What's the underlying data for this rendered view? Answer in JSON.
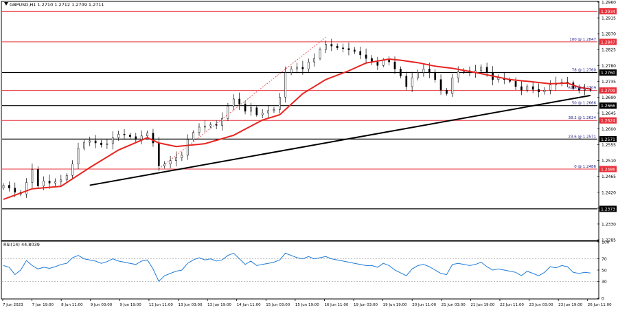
{
  "chart_data": [
    {
      "type": "candlestick",
      "symbol_header": "GBPUSD,H1  1.2710 1.2712 1.2709 1.2711",
      "ylim": [
        1.2285,
        1.296
      ],
      "y_ticks": [
        "1.2960",
        "1.2915",
        "1.2870",
        "1.2825",
        "1.2780",
        "1.2735",
        "1.2690",
        "1.2645",
        "1.2600",
        "1.2555",
        "1.2510",
        "1.2465",
        "1.2420",
        "1.2375",
        "1.2330",
        "1.2285"
      ],
      "x_ticks": [
        "7 Jun 2023",
        "7 Jun 19:00",
        "8 Jun 11:00",
        "9 Jun 03:00",
        "9 Jun 19:00",
        "12 Jun 11:00",
        "13 Jun 03:00",
        "13 Jun 19:00",
        "14 Jun 11:00",
        "15 Jun 03:00",
        "15 Jun 19:00",
        "16 Jun 11:00",
        "19 Jun 03:00",
        "19 Jun 19:00",
        "20 Jun 11:00",
        "21 Jun 03:00",
        "21 Jun 19:00",
        "22 Jun 11:00",
        "23 Jun 03:00",
        "23 Jun 19:00",
        "26 Jun 11:00"
      ],
      "horizontal_levels": [
        {
          "price": 1.2934,
          "label": "1.2934",
          "color": "#e8303a"
        },
        {
          "price": 1.2847,
          "label": "1.2847",
          "color": "#e8303a",
          "annotation": "100 @ 1.2847"
        },
        {
          "price": 1.276,
          "label": "1.2760",
          "color": "#000000",
          "annotation": "78 @ 1.2760"
        },
        {
          "price": 1.2709,
          "label": "1.2709",
          "color": "#e8303a",
          "annotation": "61.8 @ 1.2709"
        },
        {
          "price": 1.2666,
          "label": "1.2666",
          "color": "#000000",
          "annotation": "50 @ 1.2666"
        },
        {
          "price": 1.2624,
          "label": "1.2624",
          "color": "#e8303a",
          "annotation": "38.2 @ 1.2624"
        },
        {
          "price": 1.2571,
          "label": "1.2571",
          "color": "#000000",
          "annotation": "23.6 @ 1.2571"
        },
        {
          "price": 1.2486,
          "label": "1.2486",
          "color": "#e8303a",
          "annotation": "0 @ 1.2486"
        },
        {
          "price": 1.2373,
          "label": "1.2373",
          "color": "#000000"
        }
      ],
      "close_path": [
        [
          0,
          1.244
        ],
        [
          1,
          1.2432
        ],
        [
          2,
          1.242
        ],
        [
          3,
          1.2415
        ],
        [
          4,
          1.2448
        ],
        [
          5,
          1.2485
        ],
        [
          6,
          1.2438
        ],
        [
          7,
          1.2452
        ],
        [
          8,
          1.2446
        ],
        [
          9,
          1.245
        ],
        [
          10,
          1.2455
        ],
        [
          11,
          1.2468
        ],
        [
          12,
          1.25
        ],
        [
          13,
          1.2545
        ],
        [
          14,
          1.2562
        ],
        [
          15,
          1.2566
        ],
        [
          16,
          1.256
        ],
        [
          17,
          1.2555
        ],
        [
          18,
          1.2558
        ],
        [
          19,
          1.2575
        ],
        [
          20,
          1.2585
        ],
        [
          21,
          1.2583
        ],
        [
          22,
          1.2578
        ],
        [
          23,
          1.257
        ],
        [
          24,
          1.258
        ],
        [
          25,
          1.2588
        ],
        [
          26,
          1.256
        ],
        [
          27,
          1.2495
        ],
        [
          28,
          1.25
        ],
        [
          29,
          1.251
        ],
        [
          30,
          1.2518
        ],
        [
          31,
          1.2525
        ],
        [
          32,
          1.257
        ],
        [
          33,
          1.259
        ],
        [
          34,
          1.2605
        ],
        [
          35,
          1.2608
        ],
        [
          36,
          1.2612
        ],
        [
          37,
          1.261
        ],
        [
          38,
          1.263
        ],
        [
          39,
          1.2665
        ],
        [
          40,
          1.2685
        ],
        [
          41,
          1.267
        ],
        [
          42,
          1.265
        ],
        [
          43,
          1.266
        ],
        [
          44,
          1.264
        ],
        [
          45,
          1.2645
        ],
        [
          46,
          1.2652
        ],
        [
          47,
          1.2655
        ],
        [
          48,
          1.269
        ],
        [
          49,
          1.276
        ],
        [
          50,
          1.277
        ],
        [
          51,
          1.2775
        ],
        [
          52,
          1.277
        ],
        [
          53,
          1.279
        ],
        [
          54,
          1.28
        ],
        [
          55,
          1.2825
        ],
        [
          56,
          1.284
        ],
        [
          57,
          1.2835
        ],
        [
          58,
          1.283
        ],
        [
          59,
          1.2828
        ],
        [
          60,
          1.2824
        ],
        [
          61,
          1.282
        ],
        [
          62,
          1.281
        ],
        [
          63,
          1.28
        ],
        [
          64,
          1.279
        ],
        [
          65,
          1.278
        ],
        [
          66,
          1.2795
        ],
        [
          67,
          1.279
        ],
        [
          68,
          1.277
        ],
        [
          69,
          1.275
        ],
        [
          70,
          1.272
        ],
        [
          71,
          1.2745
        ],
        [
          72,
          1.276
        ],
        [
          73,
          1.277
        ],
        [
          74,
          1.276
        ],
        [
          75,
          1.274
        ],
        [
          76,
          1.271
        ],
        [
          77,
          1.27
        ],
        [
          78,
          1.2745
        ],
        [
          79,
          1.2762
        ],
        [
          80,
          1.2765
        ],
        [
          81,
          1.276
        ],
        [
          82,
          1.2765
        ],
        [
          83,
          1.2775
        ],
        [
          84,
          1.276
        ],
        [
          85,
          1.274
        ],
        [
          86,
          1.2745
        ],
        [
          87,
          1.274
        ],
        [
          88,
          1.2735
        ],
        [
          89,
          1.272
        ],
        [
          90,
          1.271
        ],
        [
          91,
          1.272
        ],
        [
          92,
          1.2712
        ],
        [
          93,
          1.2705
        ],
        [
          94,
          1.271
        ],
        [
          95,
          1.2725
        ],
        [
          96,
          1.273
        ],
        [
          97,
          1.2733
        ],
        [
          98,
          1.2731
        ],
        [
          99,
          1.2715
        ],
        [
          100,
          1.271
        ],
        [
          101,
          1.2712
        ],
        [
          102,
          1.2711
        ]
      ],
      "series": [
        {
          "name": "",
          "kind": "moving-average",
          "color": "#e8231f",
          "values": [
            [
              0,
              1.24
            ],
            [
              5,
              1.243
            ],
            [
              10,
              1.2437
            ],
            [
              15,
              1.249
            ],
            [
              20,
              1.254
            ],
            [
              25,
              1.2575
            ],
            [
              27,
              1.256
            ],
            [
              30,
              1.255
            ],
            [
              35,
              1.2558
            ],
            [
              40,
              1.2582
            ],
            [
              45,
              1.2625
            ],
            [
              48,
              1.264
            ],
            [
              52,
              1.27
            ],
            [
              56,
              1.274
            ],
            [
              60,
              1.2765
            ],
            [
              63,
              1.2787
            ],
            [
              67,
              1.2798
            ],
            [
              69,
              1.2795
            ],
            [
              72,
              1.2788
            ],
            [
              75,
              1.2778
            ],
            [
              78,
              1.2772
            ],
            [
              82,
              1.276
            ],
            [
              85,
              1.275
            ],
            [
              88,
              1.274
            ],
            [
              91,
              1.2735
            ],
            [
              95,
              1.2728
            ],
            [
              98,
              1.273
            ],
            [
              100,
              1.2718
            ],
            [
              102,
              1.2713
            ]
          ]
        },
        {
          "name": "",
          "kind": "trendline",
          "color": "#000000",
          "values": [
            [
              15,
              1.244
            ],
            [
              102,
              1.2695
            ]
          ]
        },
        {
          "name": "",
          "kind": "dashed-trendline",
          "color": "#e8303a",
          "values": [
            [
              27,
              1.2486
            ],
            [
              56,
              1.286
            ]
          ]
        }
      ]
    },
    {
      "type": "line",
      "title": "RSI(14) 44.8039",
      "ylim": [
        0,
        100
      ],
      "y_ticks": [
        "100",
        "70",
        "50",
        "30",
        "0"
      ],
      "series": [
        {
          "name": "",
          "color": "#1e7bd8",
          "values": [
            [
              0,
              58
            ],
            [
              1,
              55
            ],
            [
              2,
              42
            ],
            [
              3,
              50
            ],
            [
              4,
              67
            ],
            [
              5,
              58
            ],
            [
              6,
              52
            ],
            [
              7,
              55
            ],
            [
              8,
              53
            ],
            [
              9,
              56
            ],
            [
              10,
              60
            ],
            [
              11,
              62
            ],
            [
              12,
              72
            ],
            [
              13,
              76
            ],
            [
              14,
              70
            ],
            [
              15,
              68
            ],
            [
              16,
              66
            ],
            [
              17,
              62
            ],
            [
              18,
              65
            ],
            [
              19,
              70
            ],
            [
              20,
              66
            ],
            [
              21,
              64
            ],
            [
              22,
              62
            ],
            [
              23,
              60
            ],
            [
              24,
              66
            ],
            [
              25,
              68
            ],
            [
              26,
              52
            ],
            [
              27,
              30
            ],
            [
              28,
              40
            ],
            [
              29,
              44
            ],
            [
              30,
              48
            ],
            [
              31,
              50
            ],
            [
              32,
              62
            ],
            [
              33,
              68
            ],
            [
              34,
              72
            ],
            [
              35,
              68
            ],
            [
              36,
              70
            ],
            [
              37,
              66
            ],
            [
              38,
              68
            ],
            [
              39,
              76
            ],
            [
              40,
              80
            ],
            [
              41,
              70
            ],
            [
              42,
              60
            ],
            [
              43,
              66
            ],
            [
              44,
              58
            ],
            [
              45,
              60
            ],
            [
              46,
              62
            ],
            [
              47,
              64
            ],
            [
              48,
              68
            ],
            [
              49,
              80
            ],
            [
              50,
              76
            ],
            [
              51,
              72
            ],
            [
              52,
              70
            ],
            [
              53,
              74
            ],
            [
              54,
              70
            ],
            [
              55,
              72
            ],
            [
              56,
              74
            ],
            [
              57,
              70
            ],
            [
              58,
              68
            ],
            [
              59,
              66
            ],
            [
              60,
              64
            ],
            [
              61,
              62
            ],
            [
              62,
              60
            ],
            [
              63,
              58
            ],
            [
              64,
              58
            ],
            [
              65,
              55
            ],
            [
              66,
              62
            ],
            [
              67,
              58
            ],
            [
              68,
              50
            ],
            [
              69,
              45
            ],
            [
              70,
              40
            ],
            [
              71,
              52
            ],
            [
              72,
              58
            ],
            [
              73,
              60
            ],
            [
              74,
              56
            ],
            [
              75,
              50
            ],
            [
              76,
              44
            ],
            [
              77,
              42
            ],
            [
              78,
              60
            ],
            [
              79,
              62
            ],
            [
              80,
              60
            ],
            [
              81,
              58
            ],
            [
              82,
              60
            ],
            [
              83,
              64
            ],
            [
              84,
              56
            ],
            [
              85,
              50
            ],
            [
              86,
              52
            ],
            [
              87,
              50
            ],
            [
              88,
              48
            ],
            [
              89,
              46
            ],
            [
              90,
              40
            ],
            [
              91,
              48
            ],
            [
              92,
              44
            ],
            [
              93,
              40
            ],
            [
              94,
              46
            ],
            [
              95,
              56
            ],
            [
              96,
              54
            ],
            [
              97,
              58
            ],
            [
              98,
              56
            ],
            [
              99,
              46
            ],
            [
              100,
              44
            ],
            [
              101,
              46
            ],
            [
              102,
              44.8
            ]
          ]
        }
      ]
    }
  ]
}
